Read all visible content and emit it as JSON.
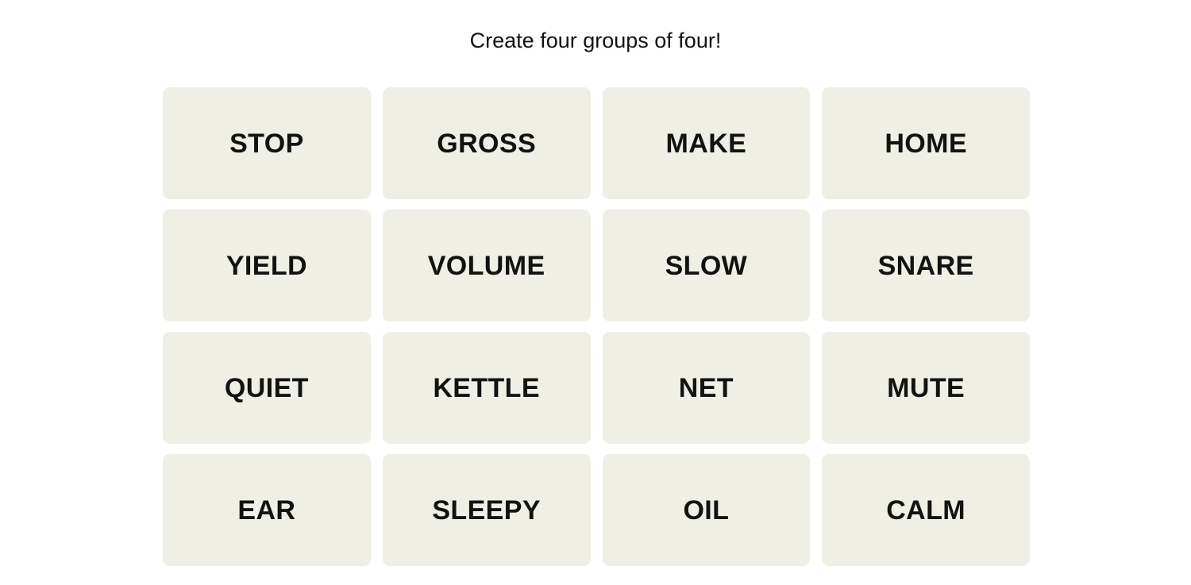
{
  "page": {
    "background_color": "#ffffff"
  },
  "header": {
    "title": "Create four groups of four!"
  },
  "board": {
    "rows": 4,
    "columns": 4,
    "tile_background_color": "#efefe6",
    "tile_text_color": "#121212",
    "tiles": [
      {
        "label": "STOP"
      },
      {
        "label": "GROSS"
      },
      {
        "label": "MAKE"
      },
      {
        "label": "HOME"
      },
      {
        "label": "YIELD"
      },
      {
        "label": "VOLUME"
      },
      {
        "label": "SLOW"
      },
      {
        "label": "SNARE"
      },
      {
        "label": "QUIET"
      },
      {
        "label": "KETTLE"
      },
      {
        "label": "NET"
      },
      {
        "label": "MUTE"
      },
      {
        "label": "EAR"
      },
      {
        "label": "SLEEPY"
      },
      {
        "label": "OIL"
      },
      {
        "label": "CALM"
      }
    ]
  }
}
